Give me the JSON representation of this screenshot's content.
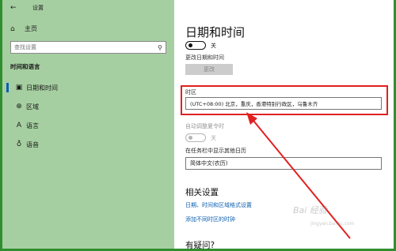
{
  "window": {
    "title": "设置"
  },
  "sidebar": {
    "home_label": "主页",
    "search_placeholder": "查找设置",
    "section_title": "时间和语言",
    "items": [
      {
        "label": "日期和时间",
        "icon": "calendar-clock-icon",
        "active": true
      },
      {
        "label": "区域",
        "icon": "globe-icon",
        "active": false
      },
      {
        "label": "语言",
        "icon": "language-icon",
        "active": false
      },
      {
        "label": "语音",
        "icon": "microphone-icon",
        "active": false
      }
    ]
  },
  "main": {
    "page_title": "日期和时间",
    "auto_time_toggle_state": "关",
    "change_datetime_label": "更改日期和时间",
    "change_button": "更改",
    "timezone_label": "时区",
    "timezone_value": "(UTC+08:00) 北京，重庆，香港特别行政区，乌鲁木齐",
    "auto_dst_label": "自动调整夏令时",
    "auto_dst_state": "关",
    "taskbar_calendar_label": "在任务栏中显示其他日历",
    "calendar_value": "简体中文(农历)",
    "related_title": "相关设置",
    "link_format": "日期、时间和区域格式设置",
    "link_clocks": "添加不同时区的时钟",
    "help_title": "有疑问?"
  },
  "watermark": {
    "text": "Bai 经验",
    "sub": "jingyan.baidu.com"
  },
  "colors": {
    "sidebar_bg": "#a6cfa1",
    "accent": "#0b5fb0",
    "highlight": "#e02020",
    "frame": "#2f8f2f"
  }
}
